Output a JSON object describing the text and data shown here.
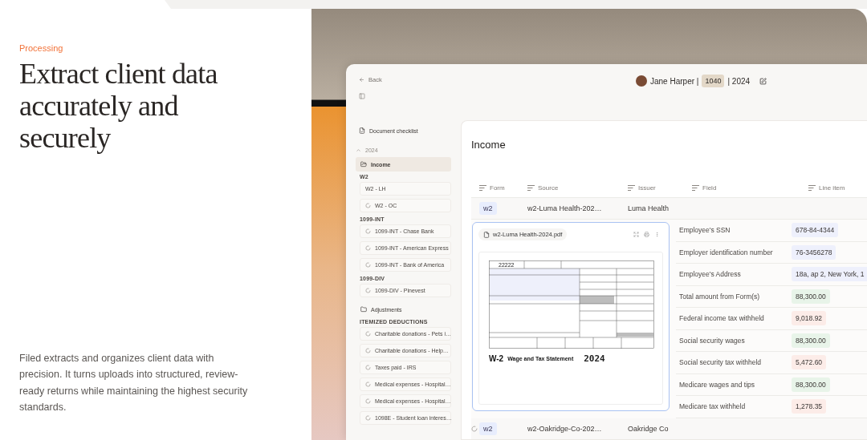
{
  "intro": {
    "eyebrow": "Processing",
    "headline": "Extract client data accurately and securely",
    "body": "Filed extracts and organizes client data with precision. It turns uploads into structured, review-ready returns while maintaining the highest security standards."
  },
  "app": {
    "back": "Back",
    "client": {
      "name": "Jane Harper |",
      "form": "1040",
      "year": "| 2024"
    },
    "sidebar": {
      "checklist": "Document checklist",
      "groups": [
        {
          "label": "2024",
          "expanded": true,
          "folders": [
            {
              "label": "Income",
              "selected": true,
              "sections": [
                {
                  "heading": "W2",
                  "docs": [
                    {
                      "label": "W2 - LH",
                      "processing": false
                    },
                    {
                      "label": "W2 - OC",
                      "processing": true
                    }
                  ]
                },
                {
                  "heading": "1099-INT",
                  "docs": [
                    {
                      "label": "1099-INT - Chase Bank",
                      "processing": true
                    },
                    {
                      "label": "1099-INT - American Express",
                      "processing": true
                    },
                    {
                      "label": "1099-INT - Bank of America",
                      "processing": true
                    }
                  ]
                },
                {
                  "heading": "1099-DIV",
                  "docs": [
                    {
                      "label": "1099-DIV - Pinevest",
                      "processing": true
                    }
                  ]
                }
              ]
            },
            {
              "label": "Adjustments",
              "selected": false,
              "sections": [
                {
                  "heading": "ITEMIZED DEDUCTIONS",
                  "docs": [
                    {
                      "label": "Charitable donations - Pets i…",
                      "processing": true
                    },
                    {
                      "label": "Charitable donations - Help…",
                      "processing": true
                    },
                    {
                      "label": "Taxes paid - IRS",
                      "processing": true
                    },
                    {
                      "label": "Medical expenses - Hospital…",
                      "processing": true
                    },
                    {
                      "label": "Medical expenses - Hospital…",
                      "processing": true
                    },
                    {
                      "label": "1098E - Student loan interes…",
                      "processing": true
                    }
                  ]
                }
              ]
            }
          ]
        }
      ]
    },
    "table": {
      "title": "Income",
      "columns": [
        "Form",
        "Source",
        "Issuer",
        "Field",
        "Line item"
      ],
      "rows": [
        {
          "form": "w2",
          "source": "w2-Luma Health-202…",
          "issuer": "Luma Health",
          "processing": false,
          "expanded": true,
          "preview": {
            "file": "w2-Luma Health-2024.pdf",
            "form_number": "22222",
            "form_name": "W-2",
            "form_title": "Wage and Tax Statement",
            "form_year": "2024"
          },
          "fields": [
            {
              "field": "Employee's SSN",
              "value": "678-84-4344",
              "color": "#eef0fc"
            },
            {
              "field": "Employer identification number",
              "value": "76-3456278",
              "color": "#eef0fc"
            },
            {
              "field": "Employee's Address",
              "value": "18a, ap 2, New York, 1",
              "color": "#eef0fc"
            },
            {
              "field": "Total amount from Form(s)",
              "value": "88,300.00",
              "color": "#e8f4e9"
            },
            {
              "field": "Federal income tax withheld",
              "value": "9,018.92",
              "color": "#fcece8"
            },
            {
              "field": "Social security wages",
              "value": "88,300.00",
              "color": "#e8f4e9"
            },
            {
              "field": "Social security tax withheld",
              "value": "5,472.60",
              "color": "#fcece8"
            },
            {
              "field": "Medicare wages and tips",
              "value": "88,300.00",
              "color": "#e8f4e9"
            },
            {
              "field": "Medicare tax withheld",
              "value": "1,278.35",
              "color": "#fcece8"
            }
          ]
        },
        {
          "form": "w2",
          "source": "w2-Oakridge-Co-202…",
          "issuer": "Oakridge Co",
          "processing": true,
          "expanded": false
        }
      ]
    }
  }
}
